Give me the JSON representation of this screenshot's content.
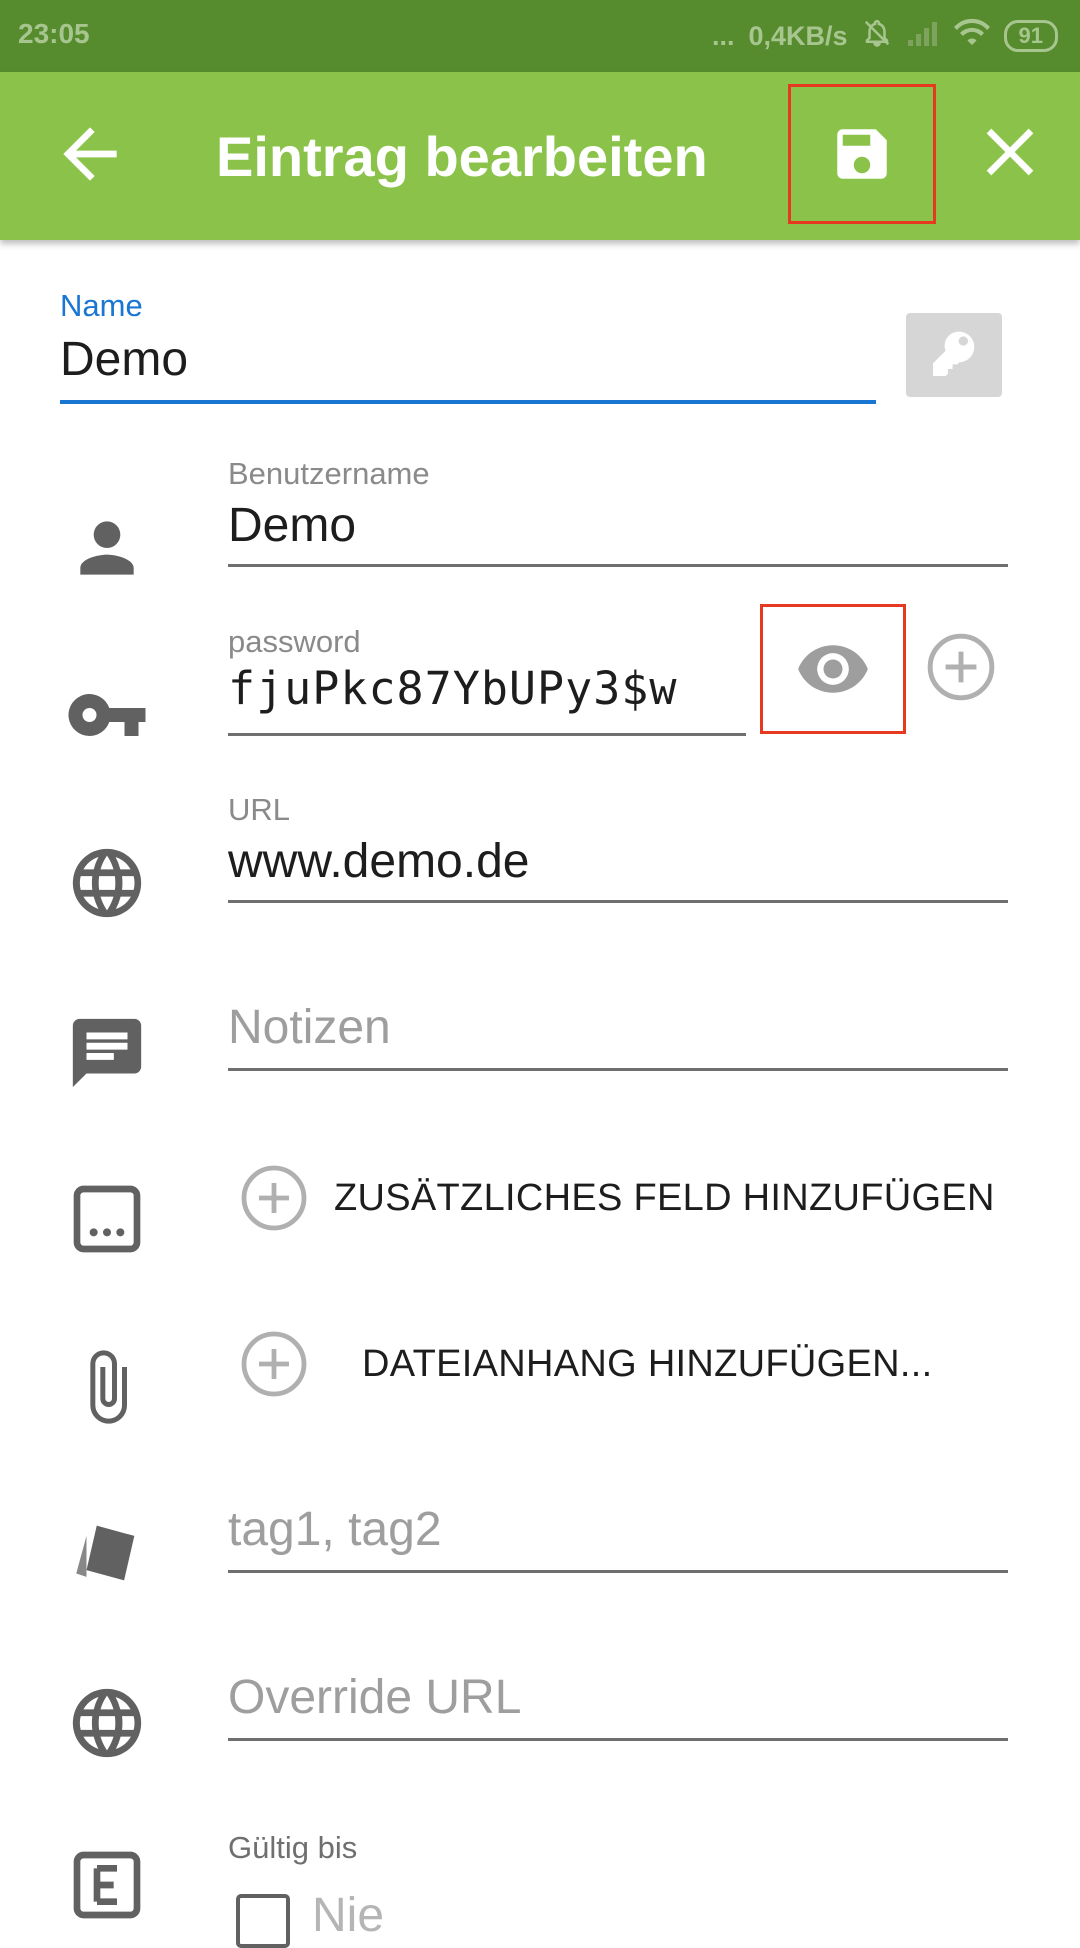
{
  "status_bar": {
    "time": "23:05",
    "dots": "...",
    "network_speed": "0,4KB/s",
    "battery": "91"
  },
  "app_bar": {
    "title": "Eintrag bearbeiten",
    "colors": {
      "toolbar": "#8bc34a",
      "status": "#578c2e",
      "highlight": "#e53a20",
      "focus": "#1976d2"
    }
  },
  "form": {
    "name": {
      "label": "Name",
      "value": "Demo"
    },
    "username": {
      "label": "Benutzername",
      "value": "Demo"
    },
    "password": {
      "label": "password",
      "value": "fjuPkc87YbUPy3$w"
    },
    "url": {
      "label": "URL",
      "value": "www.demo.de"
    },
    "notes": {
      "placeholder": "Notizen"
    },
    "add_field_label": "ZUSÄTZLICHES FELD HINZUFÜGEN",
    "add_attachment_label": "DATEIANHANG HINZUFÜGEN...",
    "tags": {
      "placeholder": "tag1, tag2"
    },
    "override_url": {
      "placeholder": "Override URL"
    },
    "expiry": {
      "label": "Gültig bis",
      "checkbox_label": "Nie"
    }
  }
}
